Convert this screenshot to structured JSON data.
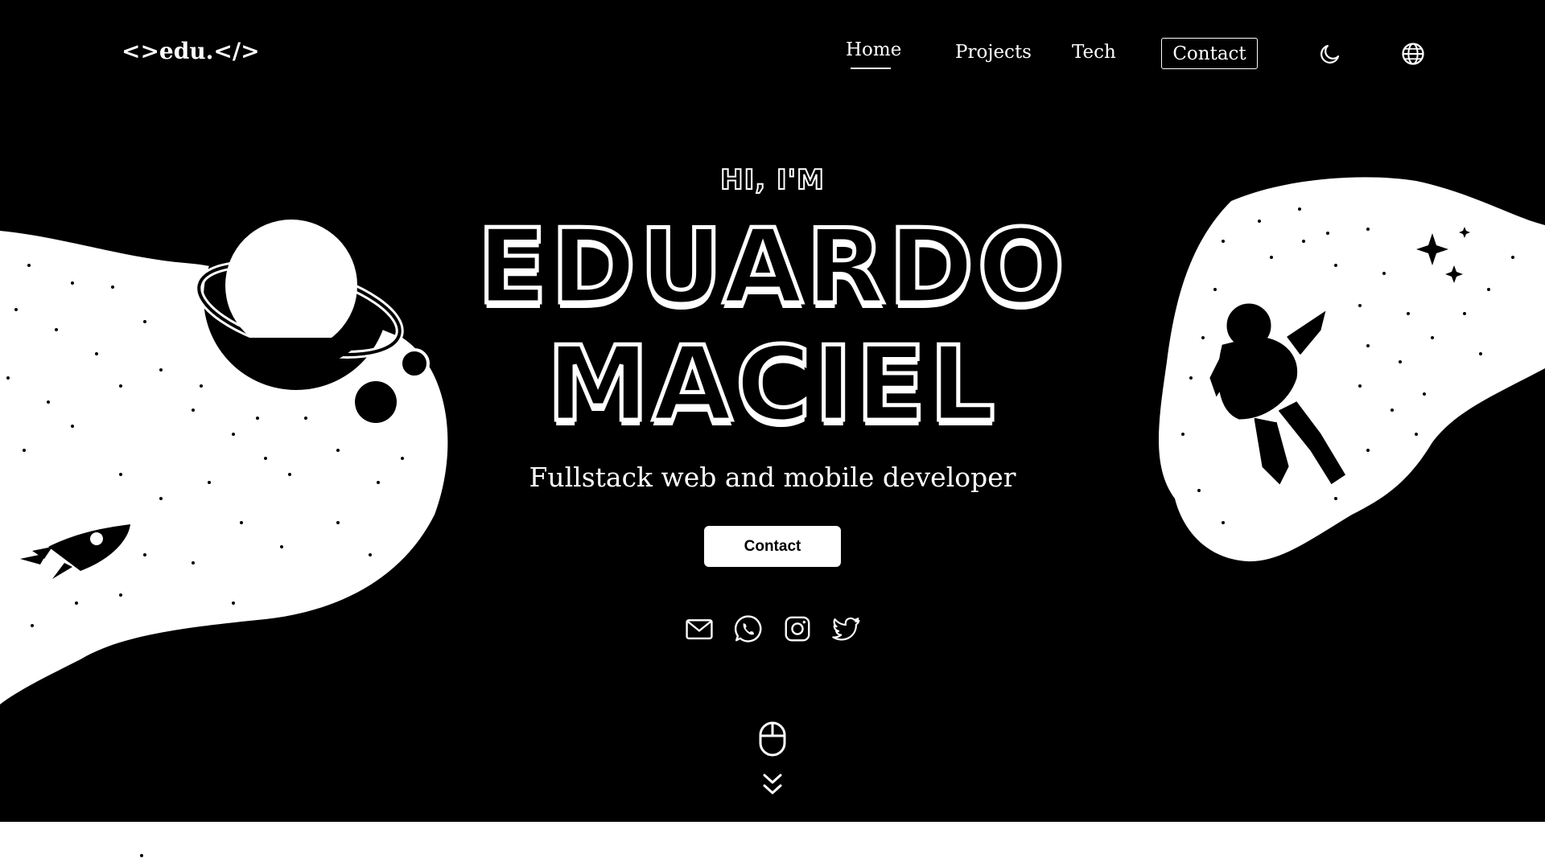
{
  "header": {
    "logo": "<>edu.</>",
    "nav": {
      "home": "Home",
      "projects": "Projects",
      "tech": "Tech",
      "contact": "Contact"
    },
    "icons": {
      "theme": "moon-icon",
      "language": "globe-icon"
    }
  },
  "hero": {
    "greeting": "HI, I'M",
    "name_line1": "EDUARDO",
    "name_line2": "MACIEL",
    "tagline": "Fullstack web and mobile developer",
    "cta_label": "Contact",
    "social": [
      "mail-icon",
      "whatsapp-icon",
      "instagram-icon",
      "twitter-icon"
    ],
    "scroll_hint": [
      "mouse-icon",
      "double-chevron-down-icon"
    ]
  },
  "colors": {
    "background": "#000000",
    "foreground": "#ffffff"
  }
}
